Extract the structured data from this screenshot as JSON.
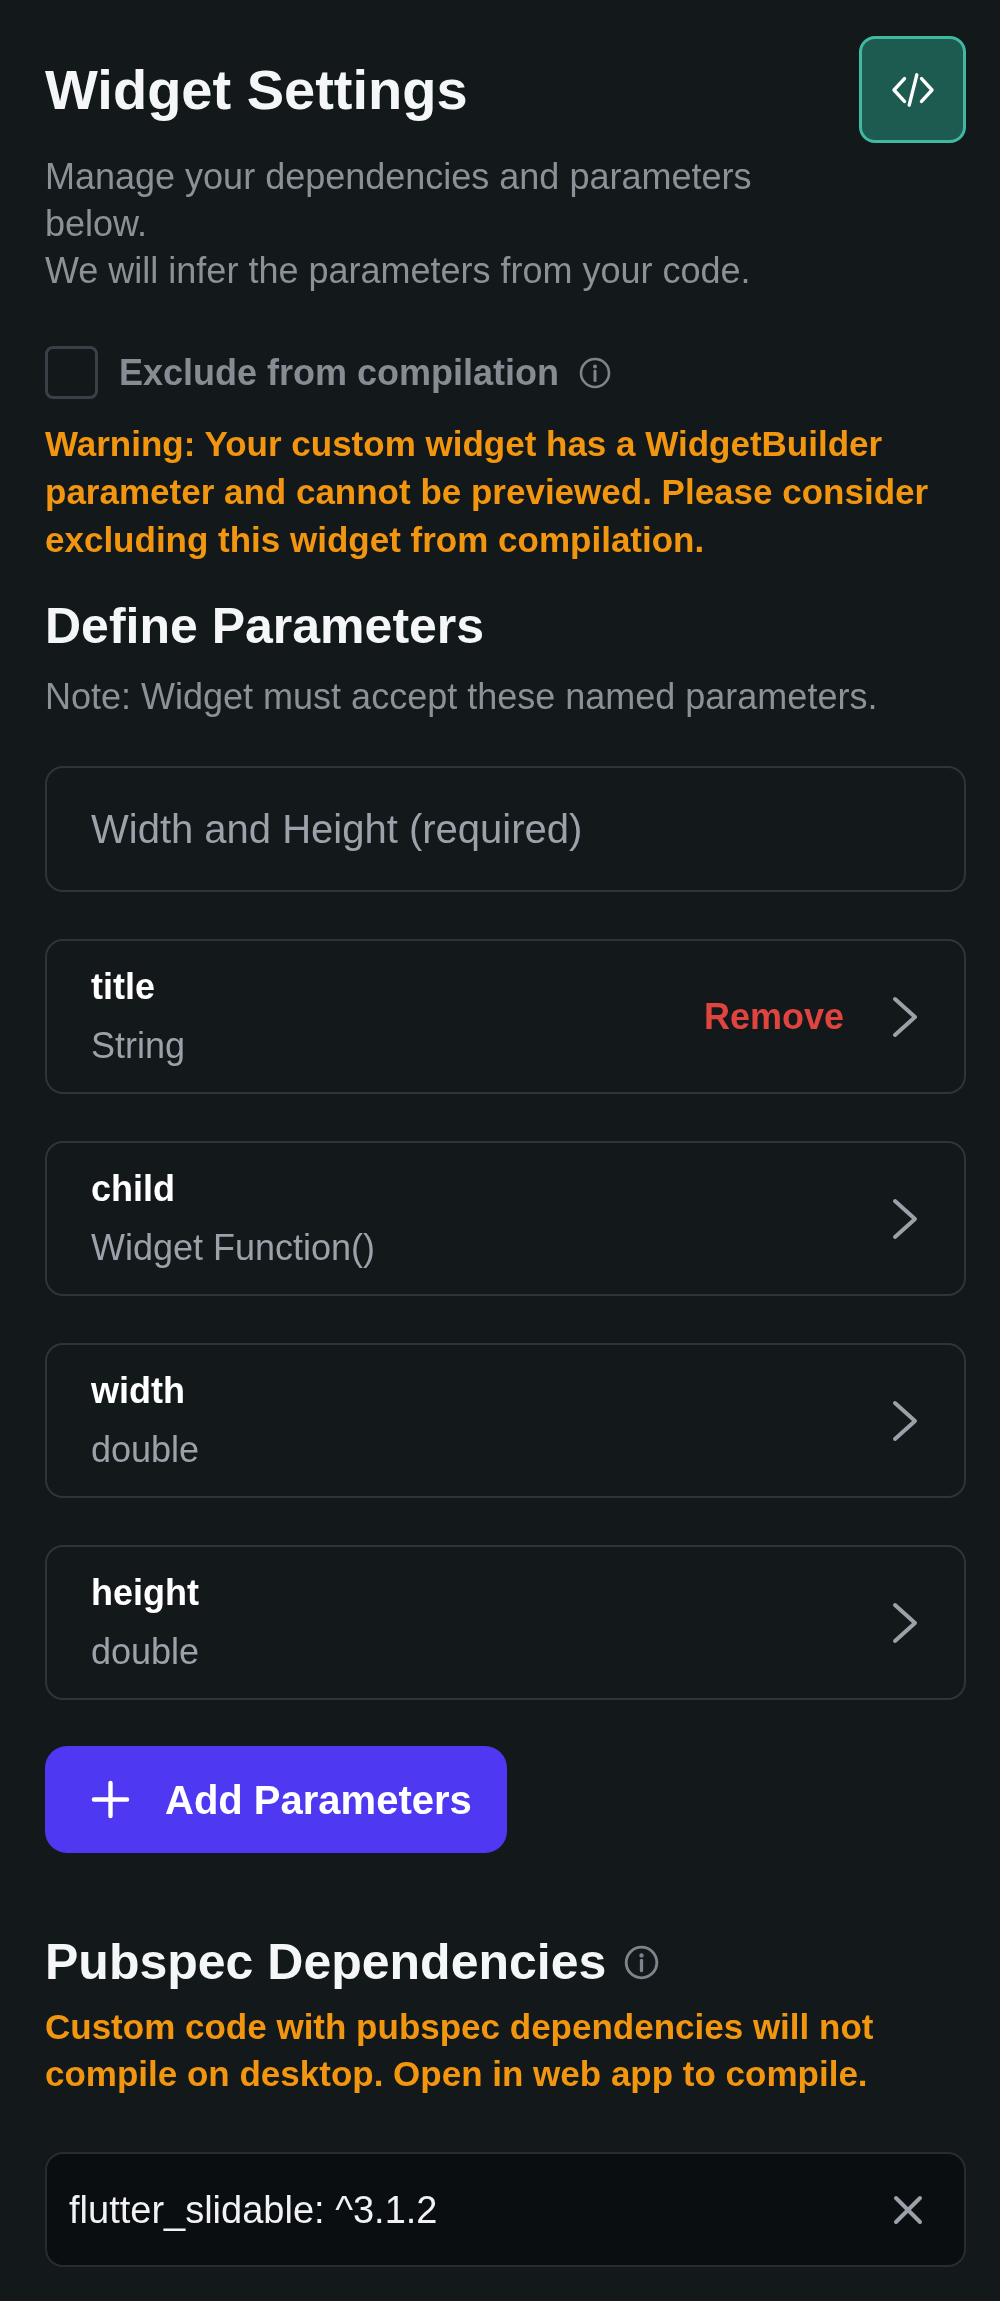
{
  "header": {
    "title": "Widget Settings",
    "description": [
      "Manage your dependencies and parameters below.",
      "We will infer the parameters from your code."
    ]
  },
  "exclude_option": {
    "label": "Exclude from compilation",
    "checked": false
  },
  "warning": "Warning: Your custom widget has a WidgetBuilder parameter and cannot be previewed. Please consider excluding this widget from compilation.",
  "parameters": {
    "title": "Define Parameters",
    "note": "Note: Widget must accept these named parameters.",
    "fixed_parameter": "Width and Height (required)",
    "items": [
      {
        "name": "title",
        "type": "String",
        "action": "Remove"
      },
      {
        "name": "child",
        "type": "Widget Function()"
      },
      {
        "name": "width",
        "type": "double"
      },
      {
        "name": "height",
        "type": "double"
      }
    ],
    "add_button": "Add Parameters"
  },
  "dependencies": {
    "title": "Pubspec Dependencies",
    "warning": "Custom code with pubspec dependencies will not compile on desktop. Open in web app to compile.",
    "items": [
      "flutter_slidable: ^3.1.2"
    ]
  }
}
